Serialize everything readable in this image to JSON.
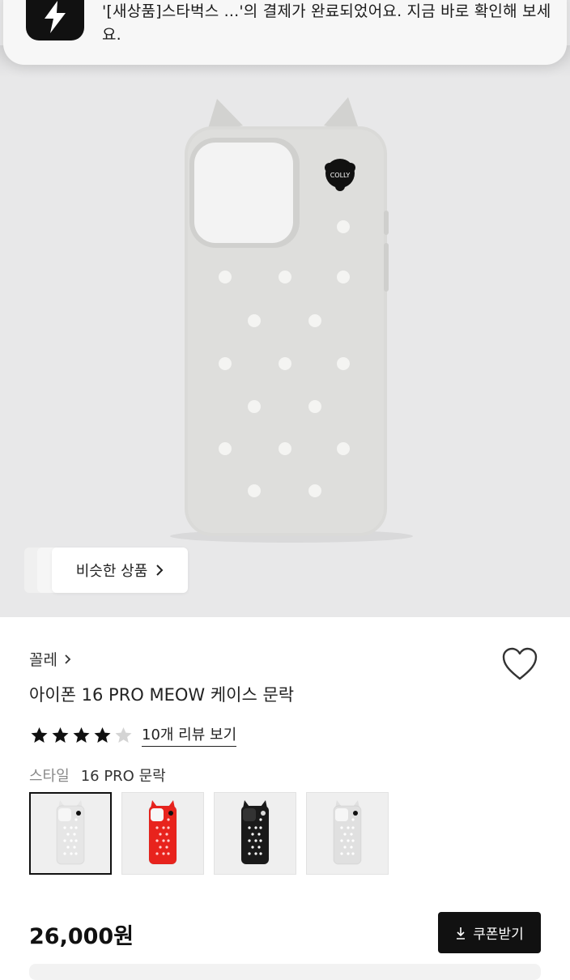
{
  "notification": {
    "app_icon": "lightning-bolt-icon",
    "message": "'[새상품]스타벅스 ...'의 결제가 완료되었어요. 지금 바로 확인해 보세요."
  },
  "hero": {
    "similar_label": "비슷한 상품",
    "similar_icon": "chevron-right-icon",
    "charm_text": "COLLY"
  },
  "product": {
    "brand": "꼴레",
    "title": "아이폰 16 PRO MEOW 케이스 문락",
    "rating": {
      "stars": 4,
      "max": 5
    },
    "review_link": "10개 리뷰 보기",
    "style_label": "스타일",
    "style_value": "16 PRO 문락",
    "thumbnails": [
      {
        "color": "#e6e6e6",
        "selected": true
      },
      {
        "color": "#e8231d",
        "selected": false
      },
      {
        "color": "#1a1a1a",
        "selected": false
      },
      {
        "color": "#e0e0e0",
        "selected": false
      }
    ],
    "price": "26,000원",
    "coupon_label": "쿠폰받기",
    "coupon_icon": "download-icon"
  }
}
